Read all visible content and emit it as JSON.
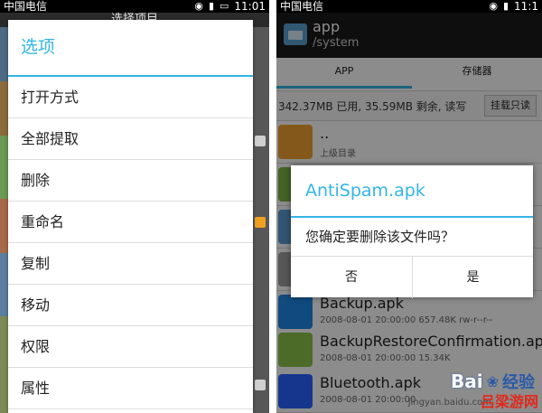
{
  "left": {
    "status_bar": {
      "carrier": "中国电信",
      "time": "11:01"
    },
    "background_title": "选择项目",
    "options_dialog": {
      "title": "选项",
      "items": [
        "打开方式",
        "全部提取",
        "删除",
        "重命名",
        "复制",
        "移动",
        "权限",
        "属性"
      ]
    }
  },
  "right": {
    "status_bar": {
      "carrier": "中国电信",
      "time": "11:1"
    },
    "header": {
      "title": "app",
      "path": "/system"
    },
    "tabs": [
      "APP",
      "存储器"
    ],
    "storage": {
      "info": "342.37MB 已用, 35.59MB 剩余, 读写",
      "mount_button": "挂载只读"
    },
    "files": [
      {
        "name": "..",
        "meta": "上级目录"
      },
      {
        "name": "",
        "meta": ""
      },
      {
        "name": "",
        "meta": ""
      },
      {
        "name": "",
        "meta": ""
      },
      {
        "name": "Backup.apk",
        "meta": "2008-08-01 20:00:00   657.48K   rw-r--r--"
      },
      {
        "name": "BackupRestoreConfirmation.apk",
        "meta": "2008-08-01 20:00:00   15.34K"
      },
      {
        "name": "Bluetooth.apk",
        "meta": "2008-08-01 20:00:00"
      }
    ],
    "delete_dialog": {
      "title": "AntiSpam.apk",
      "message": "您确定要删除该文件吗？",
      "no": "否",
      "yes": "是"
    }
  },
  "watermark": {
    "logo": "Bai",
    "brand": "经验",
    "url": "jingyan.baidu.com",
    "site": "吕梁游网"
  },
  "colors": {
    "accent": "#33b5e5",
    "status_bar": "#000000"
  },
  "icons": {
    "status": [
      "wifi-icon",
      "signal-icon",
      "battery-icon"
    ],
    "files": [
      "folder-icon",
      "apk-icon",
      "apk-icon",
      "apk-icon",
      "backup-icon",
      "android-icon",
      "bluetooth-icon"
    ]
  }
}
